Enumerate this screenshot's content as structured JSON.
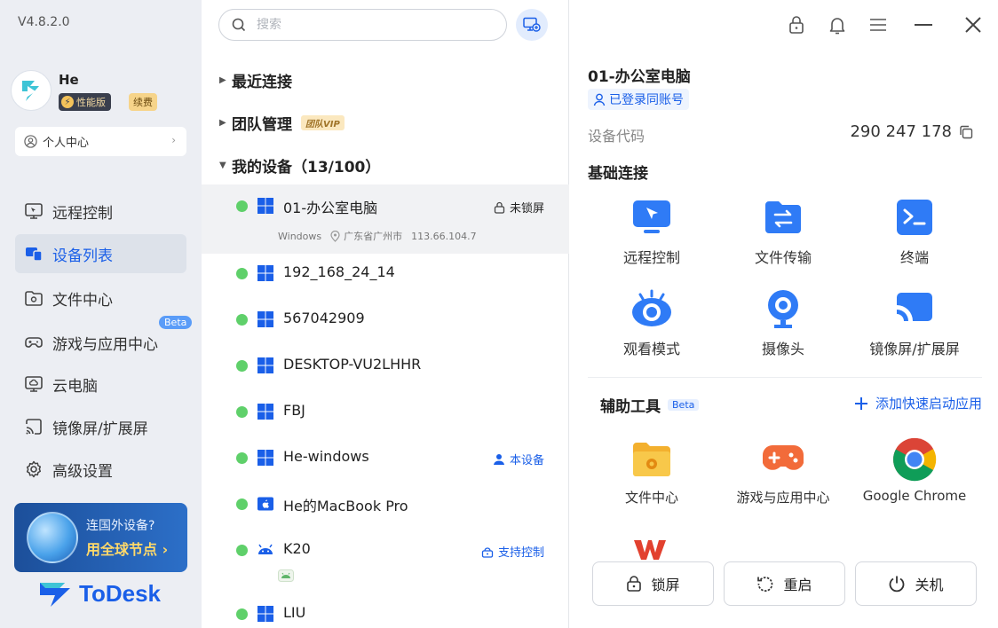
{
  "app": {
    "version": "V4.8.2.0",
    "brand": "ToDesk"
  },
  "user": {
    "name": "He",
    "tier_badge": "性能版",
    "renew_label": "续费",
    "personal_center": "个人中心"
  },
  "nav": [
    {
      "label": "远程控制",
      "icon": "monitor-icon",
      "active": false
    },
    {
      "label": "设备列表",
      "icon": "devices-icon",
      "active": true
    },
    {
      "label": "文件中心",
      "icon": "folder-icon",
      "active": false
    },
    {
      "label": "游戏与应用中心",
      "icon": "gamepad-icon",
      "active": false,
      "badge": "Beta"
    },
    {
      "label": "云电脑",
      "icon": "cloud-pc-icon",
      "active": false
    },
    {
      "label": "镜像屏/扩展屏",
      "icon": "cast-icon",
      "active": false
    },
    {
      "label": "高级设置",
      "icon": "gear-icon",
      "active": false
    }
  ],
  "promo": {
    "line1": "连国外设备?",
    "line2": "用全球节点 ›"
  },
  "search": {
    "placeholder": "搜索"
  },
  "sections": {
    "recent": "最近连接",
    "team": "团队管理",
    "team_badge": "团队VIP",
    "mine": "我的设备（13/100）"
  },
  "devices": [
    {
      "name": "01-办公室电脑",
      "os": "windows",
      "status_text": "未锁屏",
      "status_type": "lock",
      "sub_os": "Windows",
      "sub_location": "广东省广州市",
      "sub_ip": "113.66.104.7",
      "selected": true
    },
    {
      "name": "192_168_24_14",
      "os": "windows"
    },
    {
      "name": "567042909",
      "os": "windows"
    },
    {
      "name": "DESKTOP-VU2LHHR",
      "os": "windows"
    },
    {
      "name": "FBJ",
      "os": "windows"
    },
    {
      "name": "He-windows",
      "os": "windows",
      "status_text": "本设备",
      "status_type": "self"
    },
    {
      "name": "He的MacBook Pro",
      "os": "mac"
    },
    {
      "name": "K20",
      "os": "android",
      "status_text": "支持控制",
      "status_type": "control"
    },
    {
      "name": "LIU",
      "os": "windows"
    }
  ],
  "detail": {
    "title": "01-办公室电脑",
    "logged_in": "已登录同账号",
    "code_label": "设备代码",
    "code_value": "290 247 178",
    "basic_title": "基础连接",
    "basic": [
      {
        "label": "远程控制",
        "icon": "remote-control-icon"
      },
      {
        "label": "文件传输",
        "icon": "file-transfer-icon"
      },
      {
        "label": "终端",
        "icon": "terminal-icon"
      },
      {
        "label": "观看模式",
        "icon": "eye-icon"
      },
      {
        "label": "摄像头",
        "icon": "camera-icon"
      },
      {
        "label": "镜像屏/扩展屏",
        "icon": "cast-icon"
      }
    ],
    "aux_title": "辅助工具",
    "aux_badge": "Beta",
    "add_quick": "添加快速启动应用",
    "apps": [
      {
        "label": "文件中心",
        "icon": "folder-gear-icon"
      },
      {
        "label": "游戏与应用中心",
        "icon": "gamepad-icon"
      },
      {
        "label": "Google Chrome",
        "icon": "chrome-icon"
      }
    ],
    "actions": [
      {
        "label": "锁屏",
        "icon": "lock-icon"
      },
      {
        "label": "重启",
        "icon": "restart-icon"
      },
      {
        "label": "关机",
        "icon": "power-icon"
      }
    ]
  },
  "colors": {
    "accent": "#1a5fe8",
    "online": "#5fd06a",
    "sidebar_bg": "#eceef3"
  }
}
